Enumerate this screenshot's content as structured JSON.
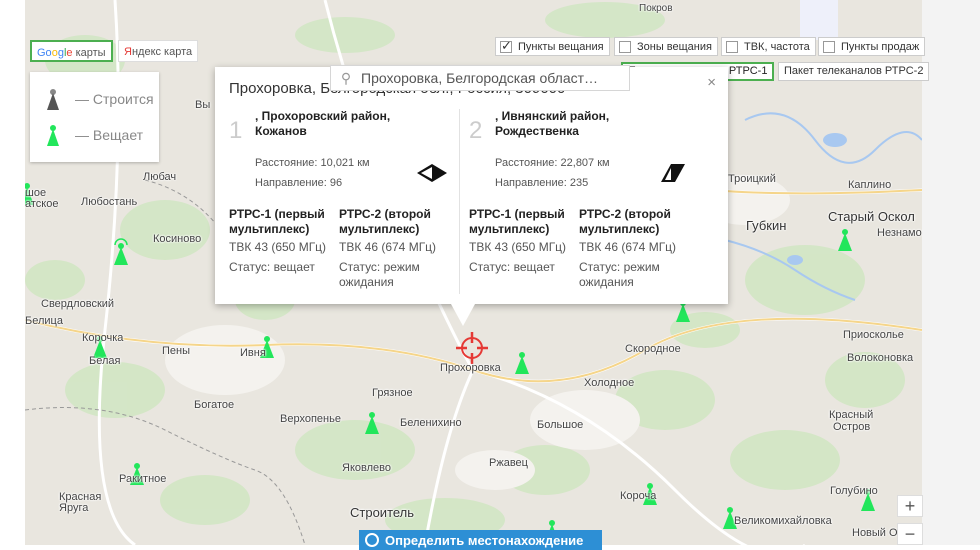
{
  "map": {
    "providers": {
      "google_part1": "Go",
      "google_o2": "o",
      "google_g": "g",
      "google_l": "l",
      "google_e": "e",
      "google_suffix": " карты",
      "yandex_y": "Я",
      "yandex_rest": "ндекс карта"
    },
    "legend": [
      {
        "label": "— Строится",
        "icon": "tower-gray-icon"
      },
      {
        "label": "— Вещает",
        "icon": "tower-green-icon"
      }
    ],
    "layers": [
      {
        "label": "Пункты вещания",
        "checked": true
      },
      {
        "label": "Зоны вещания",
        "checked": false
      },
      {
        "label": "ТВК, частота",
        "checked": false
      },
      {
        "label": "Пункты продаж",
        "checked": false
      }
    ],
    "packages": {
      "active": "Пакет телеканалов РТРС-1",
      "other": "Пакет телеканалов РТРС-2"
    },
    "search": {
      "value": "Прохоровка, Белгородская област…"
    },
    "places": [
      "Любач",
      "Любостань",
      "Косиново",
      "Свердловский",
      "Белица",
      "Корочка",
      "Белая",
      "Пены",
      "Ивня",
      "Богатое",
      "Верхопенье",
      "Грязное",
      "Беленихино",
      "Прохоровка",
      "Большое",
      "Скородное",
      "Холодное",
      "Яковлево",
      "Ржавец",
      "Ракитное",
      "Красная Яруга",
      "Строитель",
      "Короча",
      "Великомихайловка",
      "Голубино",
      "Новый О",
      "Троицкий",
      "Каплино",
      "Губкин",
      "Старый Оскол",
      "Незнамо",
      "Приоскольe",
      "Волоконовка",
      "Красный",
      "Остров",
      "Вы",
      "шое",
      "атское",
      "Покров"
    ],
    "zoom": {
      "in": "+",
      "out": "−"
    },
    "locate_label": "Определить местонахождение",
    "colors": {
      "broadcasting": "#22e65b",
      "building": "#888888",
      "accent_green": "#4caf50",
      "marker": "#e53935"
    }
  },
  "popup": {
    "title": "Прохоровка, Белгородская обл., Россия, 309000",
    "close": "×",
    "stations": [
      {
        "num": "1",
        "name": ", Прохоровский район, Кожанов",
        "distance": "Расстояние: 10,021 км",
        "direction": "Направление: 96",
        "direction_icon": "direction-arrow-east-icon",
        "mux": [
          {
            "name": "РТРС-1 (первый мультиплекс)",
            "freq": "ТВК 43 (650 МГц)",
            "status": "Статус: вещает"
          },
          {
            "name": "РТРС-2 (второй мультиплекс)",
            "freq": "ТВК 46 (674 МГц)",
            "status": "Статус: режим ожидания"
          }
        ]
      },
      {
        "num": "2",
        "name": ", Ивнянский район, Рождественка",
        "distance": "Расстояние: 22,807 км",
        "direction": "Направление: 235",
        "direction_icon": "direction-arrow-southwest-icon",
        "mux": [
          {
            "name": "РТРС-1 (первый мультиплекс)",
            "freq": "ТВК 43 (650 МГц)",
            "status": "Статус: вещает"
          },
          {
            "name": "РТРС-2 (второй мультиплекс)",
            "freq": "ТВК 46 (674 МГц)",
            "status": "Статус: режим ожидания"
          }
        ]
      }
    ]
  }
}
